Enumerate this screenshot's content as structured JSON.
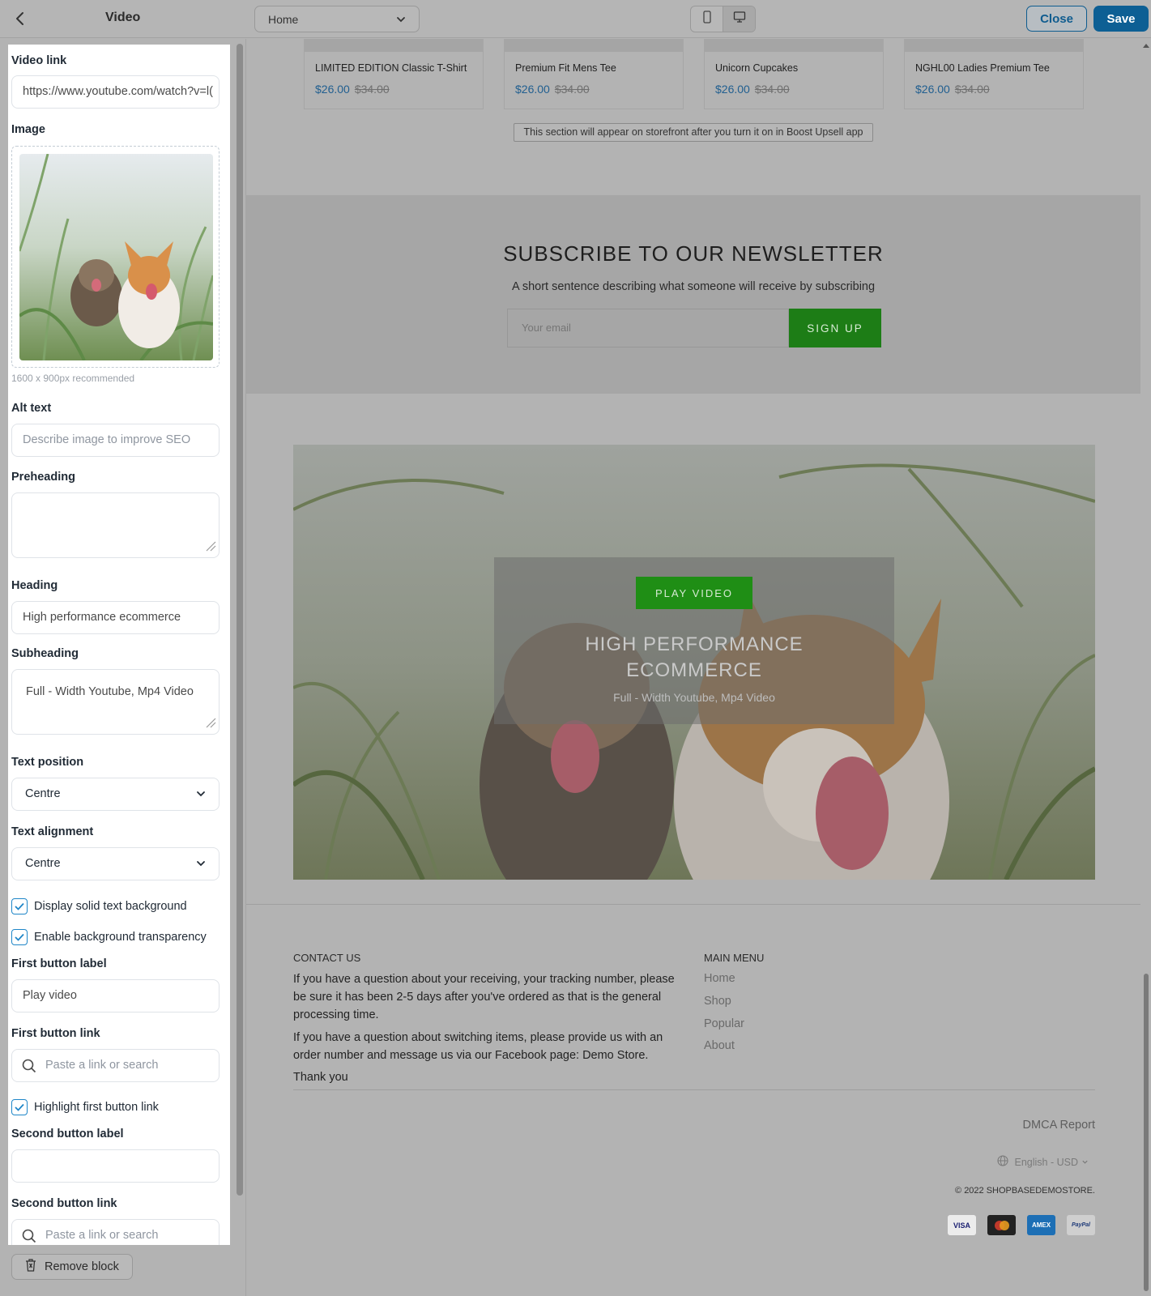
{
  "topbar": {
    "title": "Video",
    "page_selector": "Home",
    "close_label": "Close",
    "save_label": "Save"
  },
  "sidebar": {
    "video_link": {
      "label": "Video link",
      "value": "https://www.youtube.com/watch?v=l("
    },
    "image": {
      "label": "Image",
      "hint": "1600 x 900px recommended"
    },
    "alt_text": {
      "label": "Alt text",
      "placeholder": "Describe image to improve SEO"
    },
    "preheading": {
      "label": "Preheading",
      "value": ""
    },
    "heading": {
      "label": "Heading",
      "value": "High performance ecommerce"
    },
    "subheading": {
      "label": "Subheading",
      "value": "Full - Width Youtube, Mp4 Video"
    },
    "text_position": {
      "label": "Text position",
      "value": "Centre"
    },
    "text_alignment": {
      "label": "Text alignment",
      "value": "Centre"
    },
    "solid_bg": {
      "label": "Display solid text background",
      "checked": true
    },
    "bg_transparency": {
      "label": "Enable background transparency",
      "checked": true
    },
    "first_button_label": {
      "label": "First button label",
      "value": "Play video"
    },
    "first_button_link": {
      "label": "First button link",
      "placeholder": "Paste a link or search"
    },
    "highlight_first": {
      "label": "Highlight first button link",
      "checked": true
    },
    "second_button_label": {
      "label": "Second button label",
      "value": ""
    },
    "second_button_link": {
      "label": "Second button link",
      "placeholder": "Paste a link or search"
    },
    "remove_label": "Remove block"
  },
  "preview": {
    "products": [
      {
        "name": "LIMITED EDITION Classic T-Shirt",
        "price": "$26.00",
        "compare": "$34.00"
      },
      {
        "name": "Premium Fit Mens Tee",
        "price": "$26.00",
        "compare": "$34.00"
      },
      {
        "name": "Unicorn Cupcakes",
        "price": "$26.00",
        "compare": "$34.00"
      },
      {
        "name": "NGHL00 Ladies Premium Tee",
        "price": "$26.00",
        "compare": "$34.00"
      }
    ],
    "upsell_note": "This section will appear on storefront after you turn it on in Boost Upsell app",
    "newsletter": {
      "title": "SUBSCRIBE TO OUR NEWSLETTER",
      "description": "A short sentence describing what someone will receive by subscribing",
      "email_placeholder": "Your email",
      "button": "SIGN UP"
    },
    "video": {
      "button": "PLAY VIDEO",
      "heading_line1": "HIGH PERFORMANCE",
      "heading_line2": "ECOMMERCE",
      "subheading": "Full - Width Youtube, Mp4 Video"
    },
    "footer": {
      "contact_heading": "CONTACT US",
      "contact_p1": "If you have a question about your receiving, your tracking number, please be sure it has been 2-5 days after you've ordered as that is the general processing time.",
      "contact_p2": "If you have a question about switching items, please provide us with an order number and message us via our Facebook page: Demo Store.",
      "contact_p3": "Thank you",
      "menu_heading": "MAIN MENU",
      "menu": [
        "Home",
        "Shop",
        "Popular",
        "About"
      ],
      "dmca": "DMCA Report",
      "language": "English - USD",
      "copyright": "© 2022 SHOPBASEDEMOSTORE.",
      "payments": [
        "VISA",
        "AMEX",
        "PayPal"
      ]
    }
  },
  "colors": {
    "accent_blue": "#0d5f94",
    "cta_green": "#1f8e15",
    "checkbox_blue": "#1f86c8"
  },
  "icons": [
    "back-arrow-icon",
    "chevron-down-icon",
    "mobile-icon",
    "desktop-icon",
    "search-icon",
    "trash-icon",
    "globe-icon",
    "resize-grip-icon",
    "check-icon"
  ]
}
